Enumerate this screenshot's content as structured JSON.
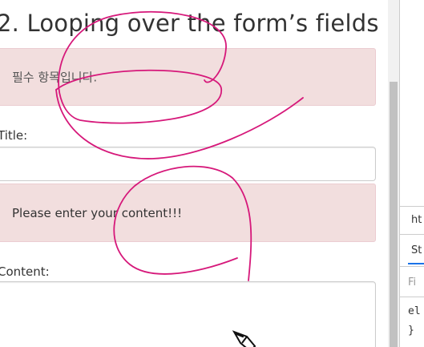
{
  "page": {
    "heading": "2. Looping over the form’s fields",
    "alerts": [
      {
        "text": "필수 항목입니다."
      },
      {
        "text": "Please enter your content!!!"
      }
    ],
    "fields": {
      "title_label": "Title:",
      "content_label": "Content:"
    }
  },
  "devtools": {
    "url_fragment": "ht",
    "tab_label": "St",
    "filter_placeholder": "Fi",
    "code_line_1": "el",
    "code_line_2": "}"
  },
  "colors": {
    "alert_bg": "#f2dede",
    "annotation_stroke": "#d6187a"
  }
}
